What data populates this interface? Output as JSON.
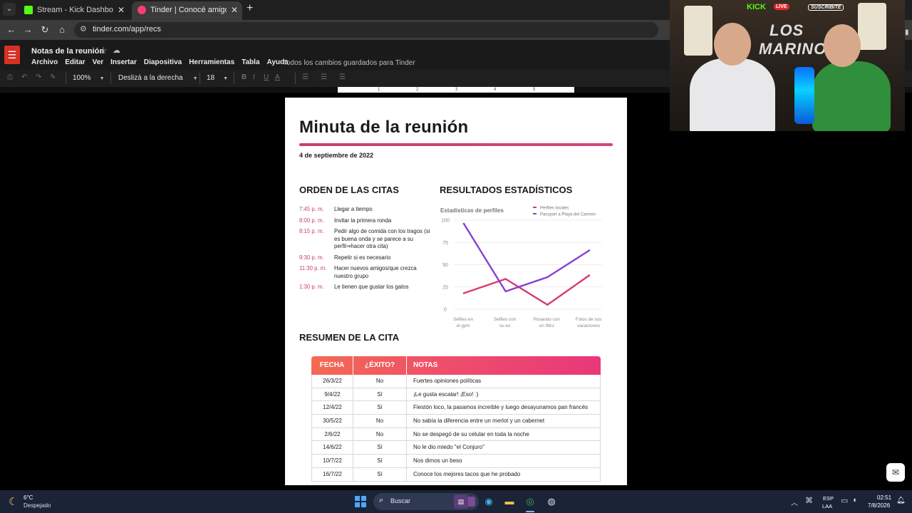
{
  "browser": {
    "tabs": [
      {
        "title": "Stream - Kick Dashboard",
        "favicon_color": "#53fc18"
      },
      {
        "title": "Tinder | Conocé amigos y gente nueva",
        "favicon_color": "#fe3c72"
      }
    ],
    "url": "tinder.com/app/recs"
  },
  "doc": {
    "title": "Notas de la reunión",
    "menus": [
      "Archivo",
      "Editar",
      "Ver",
      "Insertar",
      "Diapositiva",
      "Herramientas",
      "Tabla",
      "Ayuda"
    ],
    "save_status": "Todos los cambios guardados para Tinder",
    "toolbar": {
      "zoom": "100%",
      "style": "Deslizá a la derecha",
      "font_size": "18",
      "bold": "B",
      "italic": "I",
      "underline": "U",
      "color": "A"
    },
    "ruler_ticks": [
      "1",
      "2",
      "3",
      "4",
      "5"
    ]
  },
  "slide": {
    "title": "Minuta de la reunión",
    "date": "4 de septiembre de 2022",
    "sections": {
      "orden": "ORDEN DE LAS CITAS",
      "resultados": "RESULTADOS ESTADÍSTICOS",
      "resumen": "RESUMEN DE LA CITA"
    },
    "schedule": [
      {
        "time": "7:45  p. m.",
        "text": "Llegar a tiempo"
      },
      {
        "time": "8:00  p. m.",
        "text": "Invitar la primera ronda"
      },
      {
        "time": "8:15  p. m.",
        "text": "Pedir algo de comida con los tragos (si es buena onda y se parece a su perfil⇒hacer otra cita)"
      },
      {
        "time": "9:30  p. m.",
        "text": "Repetir si es necesario"
      },
      {
        "time": "11:30  p. m.",
        "text": "Hacer nuevos amigos/que crezca nuestro grupo"
      },
      {
        "time": "1:30  p. m.",
        "text": "Le tienen que gustar los gatos"
      }
    ],
    "table": {
      "headers": [
        "FECHA",
        "¿ÉXITO?",
        "NOTAS"
      ],
      "rows": [
        [
          "26/3/22",
          "No",
          "Fuertes opiniones políticas"
        ],
        [
          "9/4/22",
          "Sí",
          "¡Le gusta escalar! ¡Eso! :)"
        ],
        [
          "12/4/22",
          "Sí",
          "Fiestón loco, la pasamos increíble y luego desayunamos pan francés"
        ],
        [
          "30/5/22",
          "No",
          "No sabía la diferencia entre un merlot y un cabernet"
        ],
        [
          "2/6/22",
          "No",
          "No se despegó de su celular en toda la noche"
        ],
        [
          "14/6/22",
          "Sí",
          "No le dio miedo \"el Conjuro\""
        ],
        [
          "10/7/22",
          "Sí",
          "Nos dimos un beso"
        ],
        [
          "16/7/22",
          "Sí",
          "Conoce los mejores tacos que he probado"
        ]
      ]
    }
  },
  "chart_data": {
    "type": "line",
    "title": "Estadísticas de perfiles",
    "categories": [
      "Selfies en el gym",
      "Selfies con su ex",
      "Posando con un filtro",
      "Fotos de sus vacaciones"
    ],
    "category_lines": [
      [
        "Selfies en",
        "el gym"
      ],
      [
        "Selfies con",
        "su ex"
      ],
      [
        "Posando con",
        "un filtro"
      ],
      [
        "Fotos de sus",
        "vacaciones"
      ]
    ],
    "yticks": [
      "100",
      "75",
      "50",
      "25",
      "0"
    ],
    "ylim": [
      0,
      100
    ],
    "grid": true,
    "legend_position": "top-right",
    "series": [
      {
        "name": "Perfiles locales",
        "color": "#d63c6e",
        "values": [
          18,
          34,
          5,
          38
        ]
      },
      {
        "name": "Passport a Playa del Carmen",
        "color": "#8b3fd1",
        "values": [
          96,
          20,
          36,
          66
        ]
      }
    ]
  },
  "webcam": {
    "kick_label": "KICK",
    "live_label": "LIVE",
    "subscribe_label": "SUSCRIBITE",
    "logo_line1": "LOS",
    "logo_line2": "MARINO"
  },
  "taskbar": {
    "weather_temp": "6°C",
    "weather_desc": "Despejado",
    "search_placeholder": "Buscar",
    "lang1": "ESP",
    "lang2": "LAA",
    "time": "02:51",
    "date": "7/8/2026"
  }
}
